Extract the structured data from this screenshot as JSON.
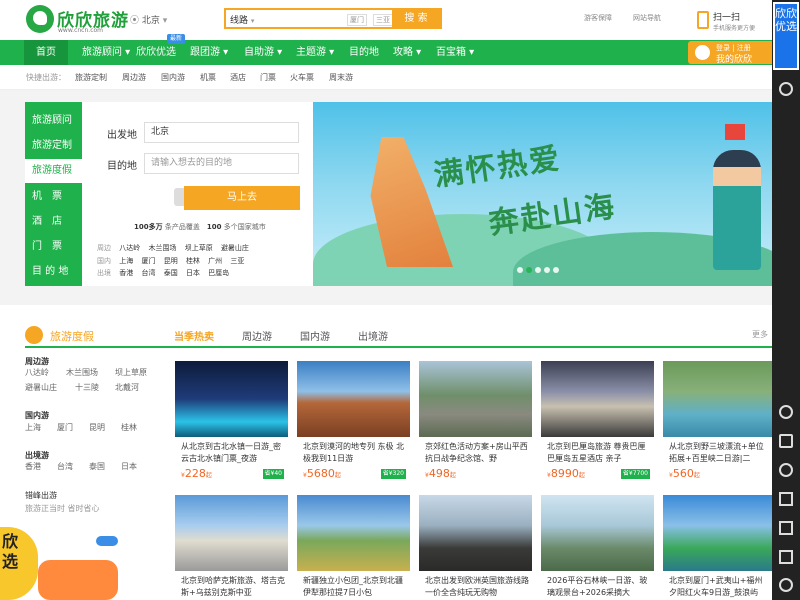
{
  "header": {
    "logo_text": "欣欣旅游",
    "logo_url": "www.cncn.com",
    "city": "北京",
    "search": {
      "type": "线路",
      "tags": [
        "厦门",
        "三亚"
      ],
      "button": "搜 索"
    },
    "links": [
      "游客保障",
      "网站导航"
    ],
    "scan": {
      "title": "扫一扫",
      "sub": "手机服务更方便"
    }
  },
  "nav": {
    "items": [
      "首页",
      "旅游顾问",
      "欣欣优选",
      "跟团游",
      "自助游",
      "主题游",
      "目的地",
      "攻略",
      "百宝箱"
    ],
    "badge": "最新",
    "login": {
      "line1": "登录 | 注册",
      "line2": "我的欣欣"
    }
  },
  "quick": {
    "label": "快捷出游：",
    "items": [
      "旅游定制",
      "周边游",
      "国内游",
      "机票",
      "酒店",
      "门票",
      "火车票",
      "周末游"
    ]
  },
  "sidenav": {
    "items": [
      "旅游顾问",
      "旅游定制",
      "旅游度假",
      "机　票",
      "酒　店",
      "门　票",
      "目 的 地"
    ]
  },
  "form": {
    "from_label": "出发地",
    "from_value": "北京",
    "to_label": "目的地",
    "to_placeholder": "请输入想去的目的地",
    "button": "马上去",
    "stat_a": "100多万",
    "stat_a_txt": "条产品覆盖",
    "stat_b": "100",
    "stat_b_txt": "多个国家城市",
    "dests": [
      {
        "k": "周边",
        "v": [
          "八达岭",
          "木兰围场",
          "坝上草原",
          "避暑山庄"
        ]
      },
      {
        "k": "国内",
        "v": [
          "上海",
          "厦门",
          "昆明",
          "桂林",
          "广州",
          "三亚"
        ]
      },
      {
        "k": "出境",
        "v": [
          "香港",
          "台湾",
          "泰国",
          "日本",
          "巴厘岛"
        ]
      }
    ]
  },
  "banner": {
    "slogan1": "满怀热爱",
    "slogan2": "奔赴山海",
    "dots": 5,
    "active_dot": 1
  },
  "section": {
    "title": "旅游度假",
    "tabs": [
      "当季热卖",
      "周边游",
      "国内游",
      "出境游"
    ],
    "more": "更多",
    "left": [
      {
        "cat": "周边游",
        "items": [
          "八达岭",
          "木兰围场",
          "坝上草原",
          "避暑山庄",
          "十三陵",
          "北戴河"
        ]
      },
      {
        "cat": "国内游",
        "items": [
          "上海",
          "厦门",
          "昆明",
          "桂林"
        ]
      },
      {
        "cat": "出境游",
        "items": [
          "香港",
          "台湾",
          "泰国",
          "日本"
        ]
      },
      {
        "cat": "错峰出游",
        "items": [
          "旅游正当时 省时省心"
        ]
      }
    ],
    "cards": [
      {
        "title": "从北京到古北水镇一日游_密云古北水镇门票_夜游",
        "price": "228",
        "save": "省¥40"
      },
      {
        "title": "北京到漠河的地专列 东极 北极我到11日游",
        "price": "5680",
        "save": "省¥320"
      },
      {
        "title": "京郊红色活动方案+房山平西抗日战争纪念馆、野",
        "price": "498",
        "save": ""
      },
      {
        "title": "北京到巴厘岛旅游 尊贵巴厘 巴厘岛五星酒店 亲子",
        "price": "8990",
        "save": "省¥7700"
      },
      {
        "title": "从北京到野三坡漂流+单位拓展+百里峡二日游|二",
        "price": "560",
        "save": ""
      },
      {
        "title": "北京到哈萨克斯旅游、塔吉克斯+乌兹别克斯中亚",
        "price": "",
        "save": ""
      },
      {
        "title": "新疆独立小包团_北京到北疆伊犁那拉提7日小包",
        "price": "",
        "save": ""
      },
      {
        "title": "北京出发到欧洲英国旅游线路一价全含纯玩无购物",
        "price": "",
        "save": ""
      },
      {
        "title": "2026平谷石林峡一日游、玻璃观景台+2026采摘大",
        "price": "",
        "save": ""
      },
      {
        "title": "北京到厦门+武夷山+福州夕阳红火车9日游_鼓浪屿",
        "price": "",
        "save": ""
      }
    ],
    "price_unit": "¥",
    "price_suffix": "起"
  },
  "rightbar": {
    "top": "欣欣优选"
  },
  "promo": {
    "text": "欣选"
  },
  "colors": {
    "green": "#1fb14b",
    "orange": "#f5a623",
    "price": "#f26522"
  }
}
